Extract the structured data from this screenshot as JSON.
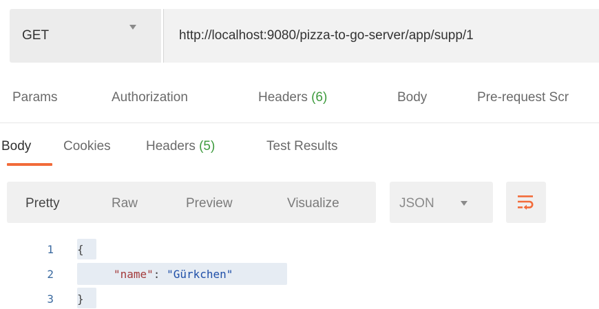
{
  "request": {
    "method": "GET",
    "url": "http://localhost:9080/pizza-to-go-server/app/supp/1"
  },
  "request_tabs": [
    {
      "label": "Params"
    },
    {
      "label": "Authorization"
    },
    {
      "label": "Headers",
      "count": "(6)"
    },
    {
      "label": "Body"
    },
    {
      "label": "Pre-request Scr"
    }
  ],
  "response_tabs": [
    {
      "label": "Body"
    },
    {
      "label": "Cookies"
    },
    {
      "label": "Headers",
      "count": "(5)"
    },
    {
      "label": "Test Results"
    }
  ],
  "format": {
    "options": [
      "Pretty",
      "Raw",
      "Preview",
      "Visualize"
    ],
    "language": "JSON"
  },
  "code": {
    "line_numbers": [
      "1",
      "2",
      "3"
    ],
    "open_brace": "{",
    "key": "\"name\"",
    "colon": ": ",
    "value": "\"Gürkchen\"",
    "close_brace": "}"
  },
  "colors": {
    "accent": "#f26b3a",
    "count_green": "#3e9b3e"
  },
  "icons": {
    "method_dropdown": "chevron-down-icon",
    "language_dropdown": "chevron-down-icon",
    "wrap": "wrap-lines-icon"
  }
}
